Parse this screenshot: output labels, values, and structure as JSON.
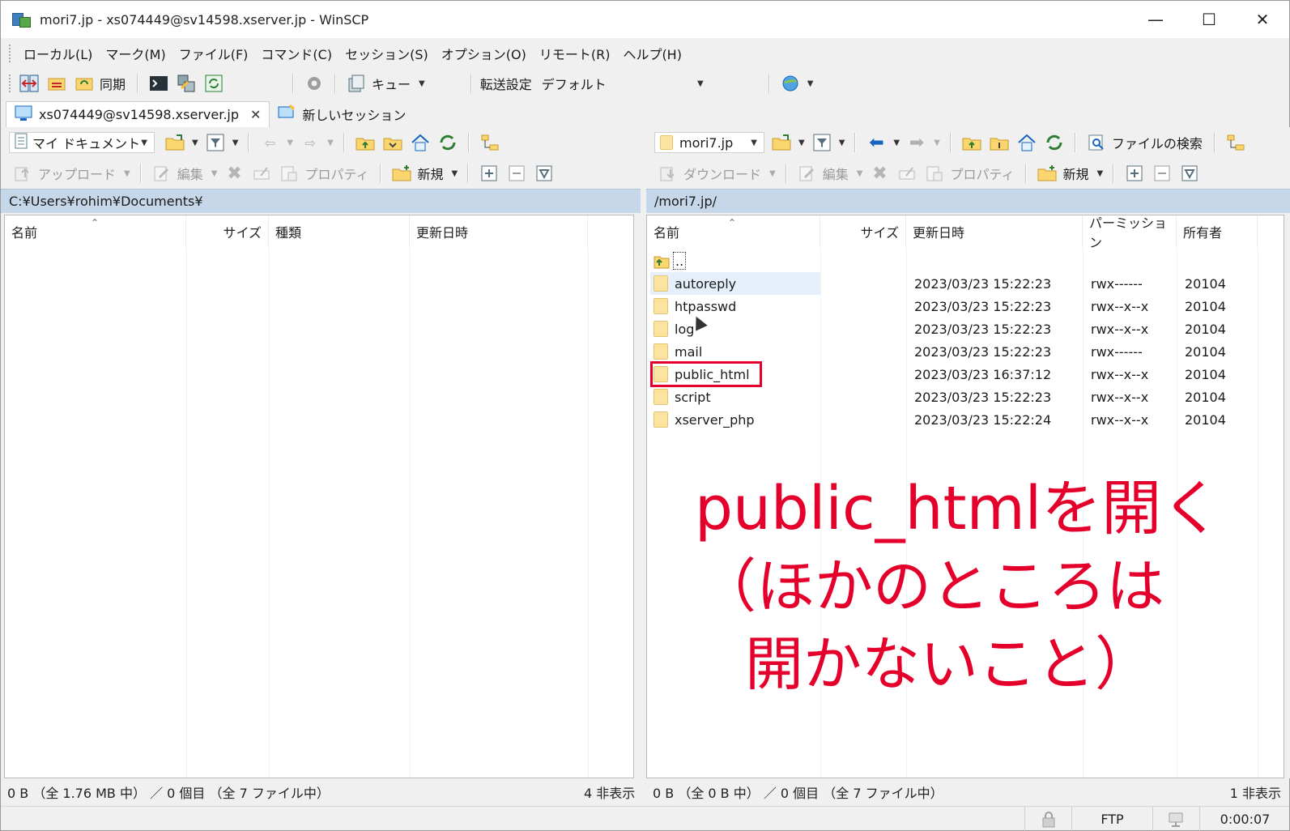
{
  "window": {
    "title": "mori7.jp - xs074449@sv14598.xserver.jp - WinSCP",
    "minimize": "—",
    "maximize": "☐",
    "close": "✕"
  },
  "menu": [
    "ローカル(L)",
    "マーク(M)",
    "ファイル(F)",
    "コマンド(C)",
    "セッション(S)",
    "オプション(O)",
    "リモート(R)",
    "ヘルプ(H)"
  ],
  "toolbar": {
    "sync_label": "同期",
    "queue_label": "キュー",
    "transfer_label": "転送設定",
    "transfer_value": "デフォルト"
  },
  "tabs": {
    "session": "xs074449@sv14598.xserver.jp",
    "new_session": "新しいセッション"
  },
  "left": {
    "location": "マイ ドキュメント",
    "upload": "アップロード",
    "edit": "編集",
    "properties": "プロパティ",
    "new": "新規",
    "path": "C:¥Users¥rohim¥Documents¥",
    "columns": [
      "名前",
      "サイズ",
      "種類",
      "更新日時"
    ],
    "status": "0 B （全 1.76 MB 中） ／ 0 個目 （全 7 ファイル中）",
    "hidden": "4 非表示"
  },
  "right": {
    "location": "mori7.jp",
    "find_files": "ファイルの検索",
    "download": "ダウンロード",
    "edit": "編集",
    "properties": "プロパティ",
    "new": "新規",
    "path": "/mori7.jp/",
    "columns": [
      "名前",
      "サイズ",
      "更新日時",
      "パーミッション",
      "所有者"
    ],
    "parent": "..",
    "files": [
      {
        "name": "autoreply",
        "date": "2023/03/23 15:22:23",
        "perm": "rwx------",
        "owner": "20104"
      },
      {
        "name": "htpasswd",
        "date": "2023/03/23 15:22:23",
        "perm": "rwx--x--x",
        "owner": "20104"
      },
      {
        "name": "log",
        "date": "2023/03/23 15:22:23",
        "perm": "rwx--x--x",
        "owner": "20104"
      },
      {
        "name": "mail",
        "date": "2023/03/23 15:22:23",
        "perm": "rwx------",
        "owner": "20104"
      },
      {
        "name": "public_html",
        "date": "2023/03/23 16:37:12",
        "perm": "rwx--x--x",
        "owner": "20104"
      },
      {
        "name": "script",
        "date": "2023/03/23 15:22:23",
        "perm": "rwx--x--x",
        "owner": "20104"
      },
      {
        "name": "xserver_php",
        "date": "2023/03/23 15:22:24",
        "perm": "rwx--x--x",
        "owner": "20104"
      }
    ],
    "status": "0 B （全 0 B 中） ／ 0 個目 （全 7 ファイル中）",
    "hidden": "1 非表示"
  },
  "statusbar": {
    "protocol": "FTP",
    "elapsed": "0:00:07"
  },
  "annotation": {
    "line1": "public_htmlを開く",
    "line2": "（ほかのところは",
    "line3": "開かないこと）"
  },
  "colors": {
    "annotation_red": "#e4002b",
    "path_bar": "#c6d7ea",
    "folder": "#fbe3a0"
  }
}
